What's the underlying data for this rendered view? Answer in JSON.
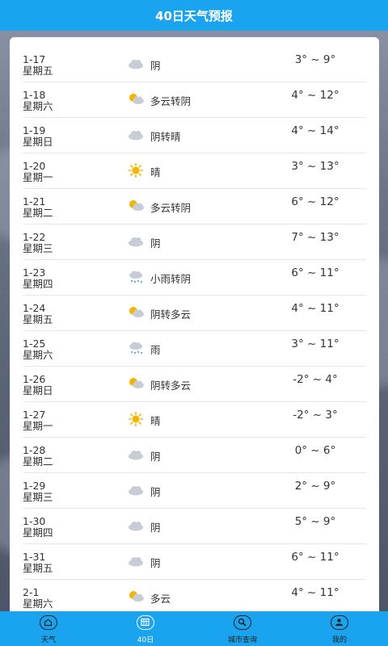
{
  "header": {
    "title": "40日天气预报"
  },
  "forecast": [
    {
      "date": "1-17",
      "weekday": "星期五",
      "icon": "cloudy-icon",
      "condition": "阴",
      "temp": "3° ~ 9°"
    },
    {
      "date": "1-18",
      "weekday": "星期六",
      "icon": "partly-cloudy-icon",
      "condition": "多云转阴",
      "temp": "4° ~ 12°"
    },
    {
      "date": "1-19",
      "weekday": "星期日",
      "icon": "cloudy-icon",
      "condition": "阴转晴",
      "temp": "4° ~ 14°"
    },
    {
      "date": "1-20",
      "weekday": "星期一",
      "icon": "sunny-icon",
      "condition": "晴",
      "temp": "3° ~ 13°"
    },
    {
      "date": "1-21",
      "weekday": "星期二",
      "icon": "partly-cloudy-icon",
      "condition": "多云转阴",
      "temp": "6° ~ 12°"
    },
    {
      "date": "1-22",
      "weekday": "星期三",
      "icon": "cloudy-icon",
      "condition": "阴",
      "temp": "7° ~ 13°"
    },
    {
      "date": "1-23",
      "weekday": "星期四",
      "icon": "rain-icon",
      "condition": "小雨转阴",
      "temp": "6° ~ 11°"
    },
    {
      "date": "1-24",
      "weekday": "星期五",
      "icon": "partly-cloudy-icon",
      "condition": "阴转多云",
      "temp": "4° ~ 11°"
    },
    {
      "date": "1-25",
      "weekday": "星期六",
      "icon": "rain-icon",
      "condition": "雨",
      "temp": "3° ~ 11°"
    },
    {
      "date": "1-26",
      "weekday": "星期日",
      "icon": "partly-cloudy-icon",
      "condition": "阴转多云",
      "temp": "-2° ~ 4°"
    },
    {
      "date": "1-27",
      "weekday": "星期一",
      "icon": "sunny-icon",
      "condition": "晴",
      "temp": "-2° ~ 3°"
    },
    {
      "date": "1-28",
      "weekday": "星期二",
      "icon": "cloudy-icon",
      "condition": "阴",
      "temp": "0° ~ 6°"
    },
    {
      "date": "1-29",
      "weekday": "星期三",
      "icon": "cloudy-icon",
      "condition": "阴",
      "temp": "2° ~ 9°"
    },
    {
      "date": "1-30",
      "weekday": "星期四",
      "icon": "cloudy-icon",
      "condition": "阴",
      "temp": "5° ~ 9°"
    },
    {
      "date": "1-31",
      "weekday": "星期五",
      "icon": "cloudy-icon",
      "condition": "阴",
      "temp": "6° ~ 11°"
    },
    {
      "date": "2-1",
      "weekday": "星期六",
      "icon": "partly-cloudy-icon",
      "condition": "多云",
      "temp": "4° ~ 11°"
    }
  ],
  "tabs": [
    {
      "label": "天气",
      "icon": "home-icon",
      "active": false
    },
    {
      "label": "40日",
      "icon": "calendar-icon",
      "active": true
    },
    {
      "label": "城市查询",
      "icon": "search-icon",
      "active": false
    },
    {
      "label": "我的",
      "icon": "user-icon",
      "active": false
    }
  ],
  "colors": {
    "accent": "#1aa3ef",
    "sun": "#f5b400",
    "cloud": "#c8ccd4",
    "rain": "#5aa7e6"
  }
}
